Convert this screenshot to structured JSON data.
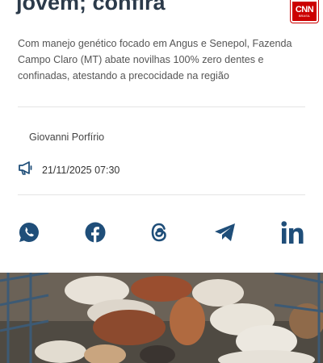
{
  "article": {
    "headline_tail": "jovem; confira",
    "subtitle": "Com manejo genético focado em Angus e Senepol, Fazenda Campo Claro (MT) abate novilhas 100% zero dentes e confinadas, atestando a precocidade na região",
    "author": "Giovanni Porfírio",
    "datetime": "21/11/2025 07:30"
  },
  "brand": {
    "logo": "CNN",
    "sub": "BRASIL",
    "color": "#cc0000"
  },
  "share": {
    "color": "#1f4e79",
    "buttons": [
      {
        "name": "whatsapp-icon"
      },
      {
        "name": "facebook-icon"
      },
      {
        "name": "threads-icon"
      },
      {
        "name": "telegram-icon"
      },
      {
        "name": "linkedin-icon"
      }
    ]
  },
  "icons": {
    "date": "megaphone-icon"
  },
  "photo": {
    "subject": "cattle-in-feedlot-pen"
  }
}
